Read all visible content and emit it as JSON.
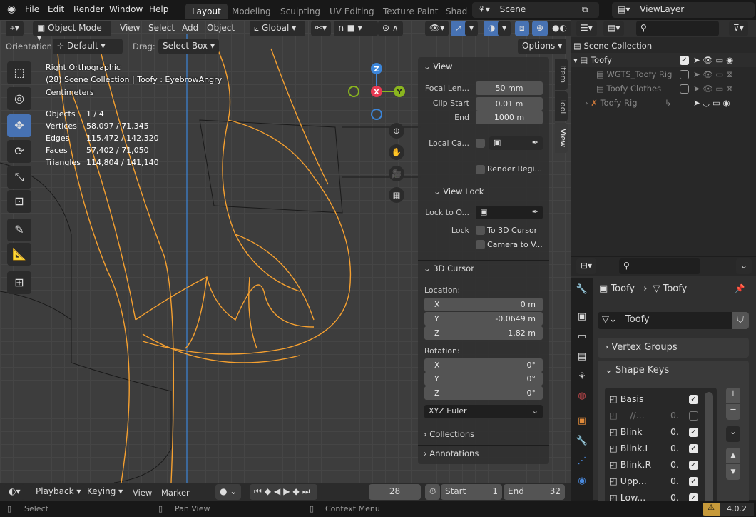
{
  "topbar": {
    "menus": [
      "File",
      "Edit",
      "Render",
      "Window",
      "Help"
    ],
    "workspaces": [
      "Layout",
      "Modeling",
      "Sculpting",
      "UV Editing",
      "Texture Paint",
      "Shad"
    ],
    "scene": "Scene",
    "view_layer": "ViewLayer"
  },
  "viewport_header": {
    "mode": "Object Mode",
    "menus": [
      "View",
      "Select",
      "Add",
      "Object"
    ],
    "transform_orientation": "Global"
  },
  "tool_settings": {
    "orientation_label": "Orientation:",
    "orientation_value": "Default",
    "drag_label": "Drag:",
    "drag_value": "Select Box",
    "options": "Options"
  },
  "overlay": {
    "view_name": "Right Orthographic",
    "collection": "(28) Scene Collection | Toofy : EyebrowAngry",
    "units": "Centimeters",
    "stats": [
      {
        "label": "Objects",
        "value": "1 / 4"
      },
      {
        "label": "Vertices",
        "value": "58,097 / 71,345"
      },
      {
        "label": "Edges",
        "value": "115,472 / 142,320"
      },
      {
        "label": "Faces",
        "value": "57,402 / 71,050"
      },
      {
        "label": "Triangles",
        "value": "114,804 / 141,140"
      }
    ]
  },
  "gizmo": {
    "z": "Z",
    "x": "X",
    "y": "Y"
  },
  "npanel": {
    "tabs": [
      "Item",
      "Tool",
      "View"
    ],
    "view": {
      "title": "View",
      "focal_label": "Focal Len...",
      "focal": "50 mm",
      "clip_start_label": "Clip Start",
      "clip_start": "0.01 m",
      "end_label": "End",
      "end": "1000 m",
      "local_cam_label": "Local Ca...",
      "render_region": "Render Regi..."
    },
    "view_lock": {
      "title": "View Lock",
      "lock_to_label": "Lock to O...",
      "lock_label": "Lock",
      "to_3d_cursor": "To 3D Cursor",
      "camera_to_view": "Camera to V..."
    },
    "cursor": {
      "title": "3D Cursor",
      "location_label": "Location:",
      "x_label": "X",
      "x": "0 m",
      "y_label": "Y",
      "y": "-0.0649 m",
      "z_label": "Z",
      "z": "1.82 m",
      "rotation_label": "Rotation:",
      "rx": "0°",
      "ry": "0°",
      "rz": "0°",
      "rotation_mode": "XYZ Euler"
    },
    "collections": "Collections",
    "annotations": "Annotations"
  },
  "outliner": {
    "root": "Scene Collection",
    "items": [
      {
        "name": "Toofy",
        "checked": true,
        "dim": false
      },
      {
        "name": "WGTS_Toofy Rig",
        "checked": false,
        "dim": true
      },
      {
        "name": "Toofy Clothes",
        "checked": false,
        "dim": true
      },
      {
        "name": "Toofy Rig",
        "checked": null,
        "dim": true
      }
    ]
  },
  "properties": {
    "object": "Toofy",
    "mesh": "Toofy",
    "data_name": "Toofy",
    "vertex_groups": "Vertex Groups",
    "shape_keys": "Shape Keys",
    "keys": [
      {
        "name": "Basis",
        "value": "",
        "on": true
      },
      {
        "name": "---//...",
        "value": "0.",
        "on": false
      },
      {
        "name": "Blink",
        "value": "0.",
        "on": true
      },
      {
        "name": "Blink.L",
        "value": "0.",
        "on": true
      },
      {
        "name": "Blink.R",
        "value": "0.",
        "on": true
      },
      {
        "name": "Upp...",
        "value": "0.",
        "on": true
      },
      {
        "name": "Low...",
        "value": "0.",
        "on": true
      }
    ]
  },
  "timeline": {
    "playback": "Playback",
    "keying": "Keying",
    "view": "View",
    "marker": "Marker",
    "frame": "28",
    "start_label": "Start",
    "start": "1",
    "end_label": "End",
    "end": "32"
  },
  "status": {
    "select": "Select",
    "pan": "Pan View",
    "context": "Context Menu",
    "version": "4.0.2"
  },
  "colors": {
    "accent": "#4772b3",
    "wire": "#f5a030",
    "axis_x": "#e83a52",
    "axis_y": "#8ab51f",
    "axis_z": "#3c85d8"
  }
}
